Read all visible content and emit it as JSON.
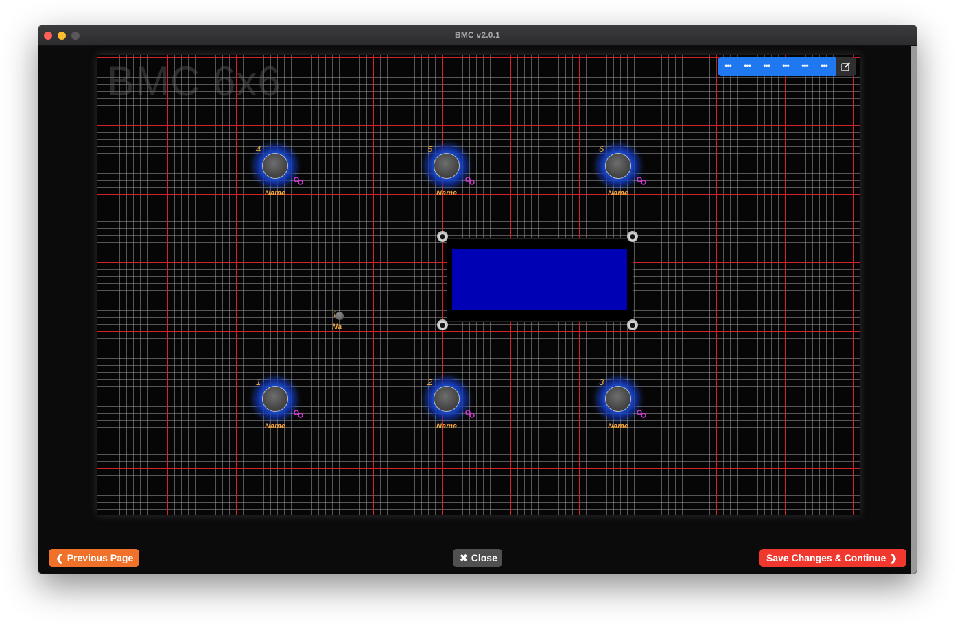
{
  "window": {
    "title": "BMC v2.0.1"
  },
  "device": {
    "name": "BMC 6x6"
  },
  "toolbar": {
    "buttons": [
      "•••",
      "•••",
      "•••",
      "•••",
      "•••",
      "•••"
    ],
    "edit_icon": "edit-icon"
  },
  "knobs": [
    {
      "number": "4",
      "label": "Name"
    },
    {
      "number": "5",
      "label": "Name"
    },
    {
      "number": "6",
      "label": "Name"
    },
    {
      "number": "1",
      "label": "Name"
    },
    {
      "number": "2",
      "label": "Name"
    },
    {
      "number": "3",
      "label": "Name"
    }
  ],
  "led": {
    "number": "1",
    "label": "Na"
  },
  "footer": {
    "previous": "Previous Page",
    "close": "Close",
    "save": "Save Changes & Continue"
  },
  "colors": {
    "grid_major": "#d62228",
    "grid_minor": "#969696",
    "knob_ring": "#2b6cff",
    "label": "#f2a43a",
    "display_screen": "#0000b4",
    "toolbar": "#1f78f0",
    "previous_button": "#f0712a",
    "close_button": "#505050",
    "save_button": "#f0382f"
  }
}
